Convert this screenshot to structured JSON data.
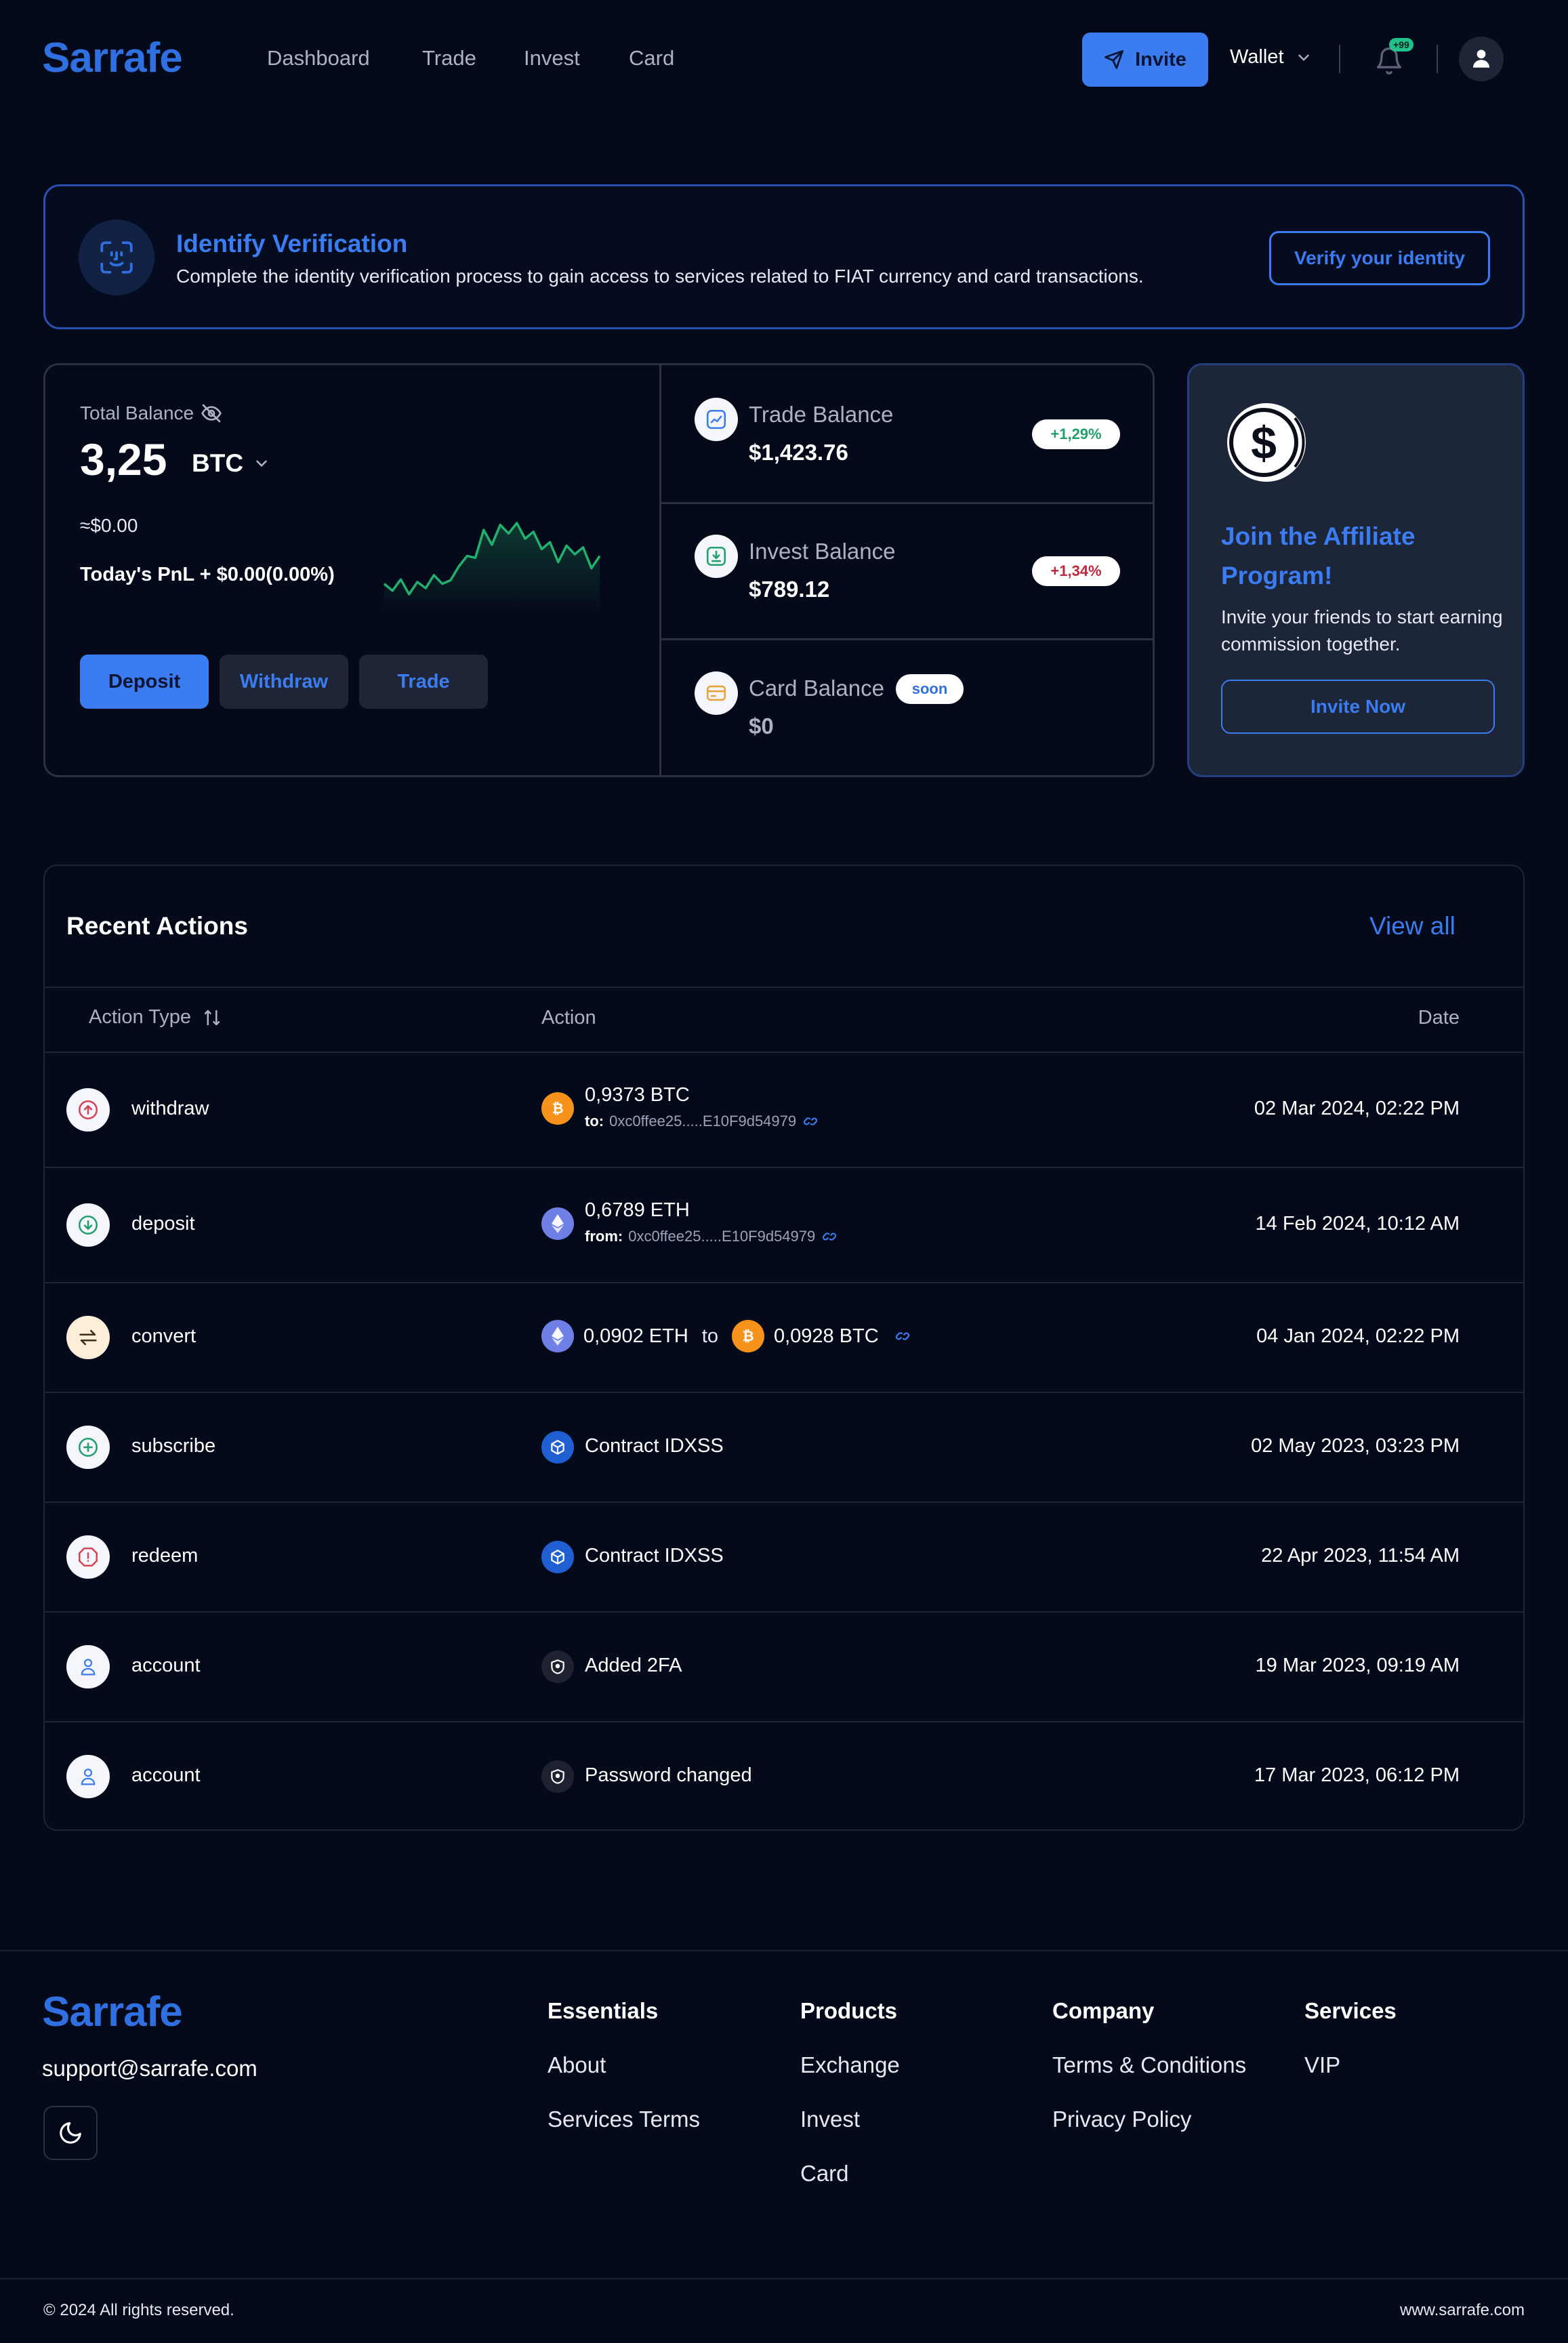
{
  "header": {
    "logo": "Sarrafe",
    "nav": [
      "Dashboard",
      "Trade",
      "Invest",
      "Card"
    ],
    "invite_label": "Invite",
    "wallet_label": "Wallet",
    "notification_count": "+99"
  },
  "verification": {
    "title": "Identify Verification",
    "description": "Complete the identity verification process to gain access to services related to FIAT currency and card transactions.",
    "button": "Verify your identity"
  },
  "balance": {
    "total_label": "Total Balance",
    "amount": "3,25",
    "currency": "BTC",
    "fiat_equiv": "≈$0.00",
    "pnl": "Today's PnL + $0.00(0.00%)",
    "buttons": {
      "deposit": "Deposit",
      "withdraw": "Withdraw",
      "trade": "Trade"
    },
    "sparkline": [
      0.3,
      0.22,
      0.35,
      0.18,
      0.32,
      0.25,
      0.4,
      0.3,
      0.34,
      0.5,
      0.62,
      0.6,
      0.92,
      0.75,
      0.98,
      0.88,
      1.0,
      0.82,
      0.9,
      0.7,
      0.78,
      0.55,
      0.74,
      0.64,
      0.72,
      0.48,
      0.62
    ]
  },
  "sub_balances": [
    {
      "label": "Trade Balance",
      "value": "$1,423.76",
      "change": "+1,29%",
      "change_color": "#22a06b"
    },
    {
      "label": "Invest Balance",
      "value": "$789.12",
      "change": "+1,34%",
      "change_color": "#c0263d"
    },
    {
      "label": "Card Balance",
      "value": "$0",
      "tag": "soon"
    }
  ],
  "affiliate": {
    "title": "Join the Affiliate Program!",
    "description": "Invite your friends to start earning commission together.",
    "button": "Invite Now"
  },
  "recent": {
    "title": "Recent Actions",
    "view_all": "View all",
    "columns": {
      "type": "Action Type",
      "action": "Action",
      "date": "Date"
    },
    "rows": [
      {
        "type": "withdraw",
        "amount": "0,9373 BTC",
        "addr_label": "to:",
        "addr": "0xc0ffee25.....E10F9d54979",
        "date": "02 Mar 2024, 02:22 PM"
      },
      {
        "type": "deposit",
        "amount": "0,6789 ETH",
        "addr_label": "from:",
        "addr": "0xc0ffee25.....E10F9d54979",
        "date": "14 Feb 2024, 10:12 AM"
      },
      {
        "type": "convert",
        "from": "0,0902 ETH",
        "to_word": "to",
        "to": "0,0928 BTC",
        "date": "04 Jan 2024, 02:22 PM"
      },
      {
        "type": "subscribe",
        "action": "Contract IDXSS",
        "date": "02 May 2023, 03:23 PM"
      },
      {
        "type": "redeem",
        "action": "Contract IDXSS",
        "date": "22 Apr 2023, 11:54 AM"
      },
      {
        "type": "account",
        "action": "Added 2FA",
        "date": "19 Mar 2023, 09:19 AM"
      },
      {
        "type": "account",
        "action": "Password changed",
        "date": "17 Mar 2023, 06:12 PM"
      }
    ]
  },
  "footer": {
    "logo": "Sarrafe",
    "email": "support@sarrafe.com",
    "columns": [
      {
        "title": "Essentials",
        "links": [
          "About",
          "Services Terms"
        ]
      },
      {
        "title": "Products",
        "links": [
          "Exchange",
          "Invest",
          "Card"
        ]
      },
      {
        "title": "Company",
        "links": [
          "Terms & Conditions",
          "Privacy Policy"
        ]
      },
      {
        "title": "Services",
        "links": [
          "VIP"
        ]
      }
    ],
    "copyright": "© 2024 All rights reserved.",
    "site": "www.sarrafe.com"
  }
}
